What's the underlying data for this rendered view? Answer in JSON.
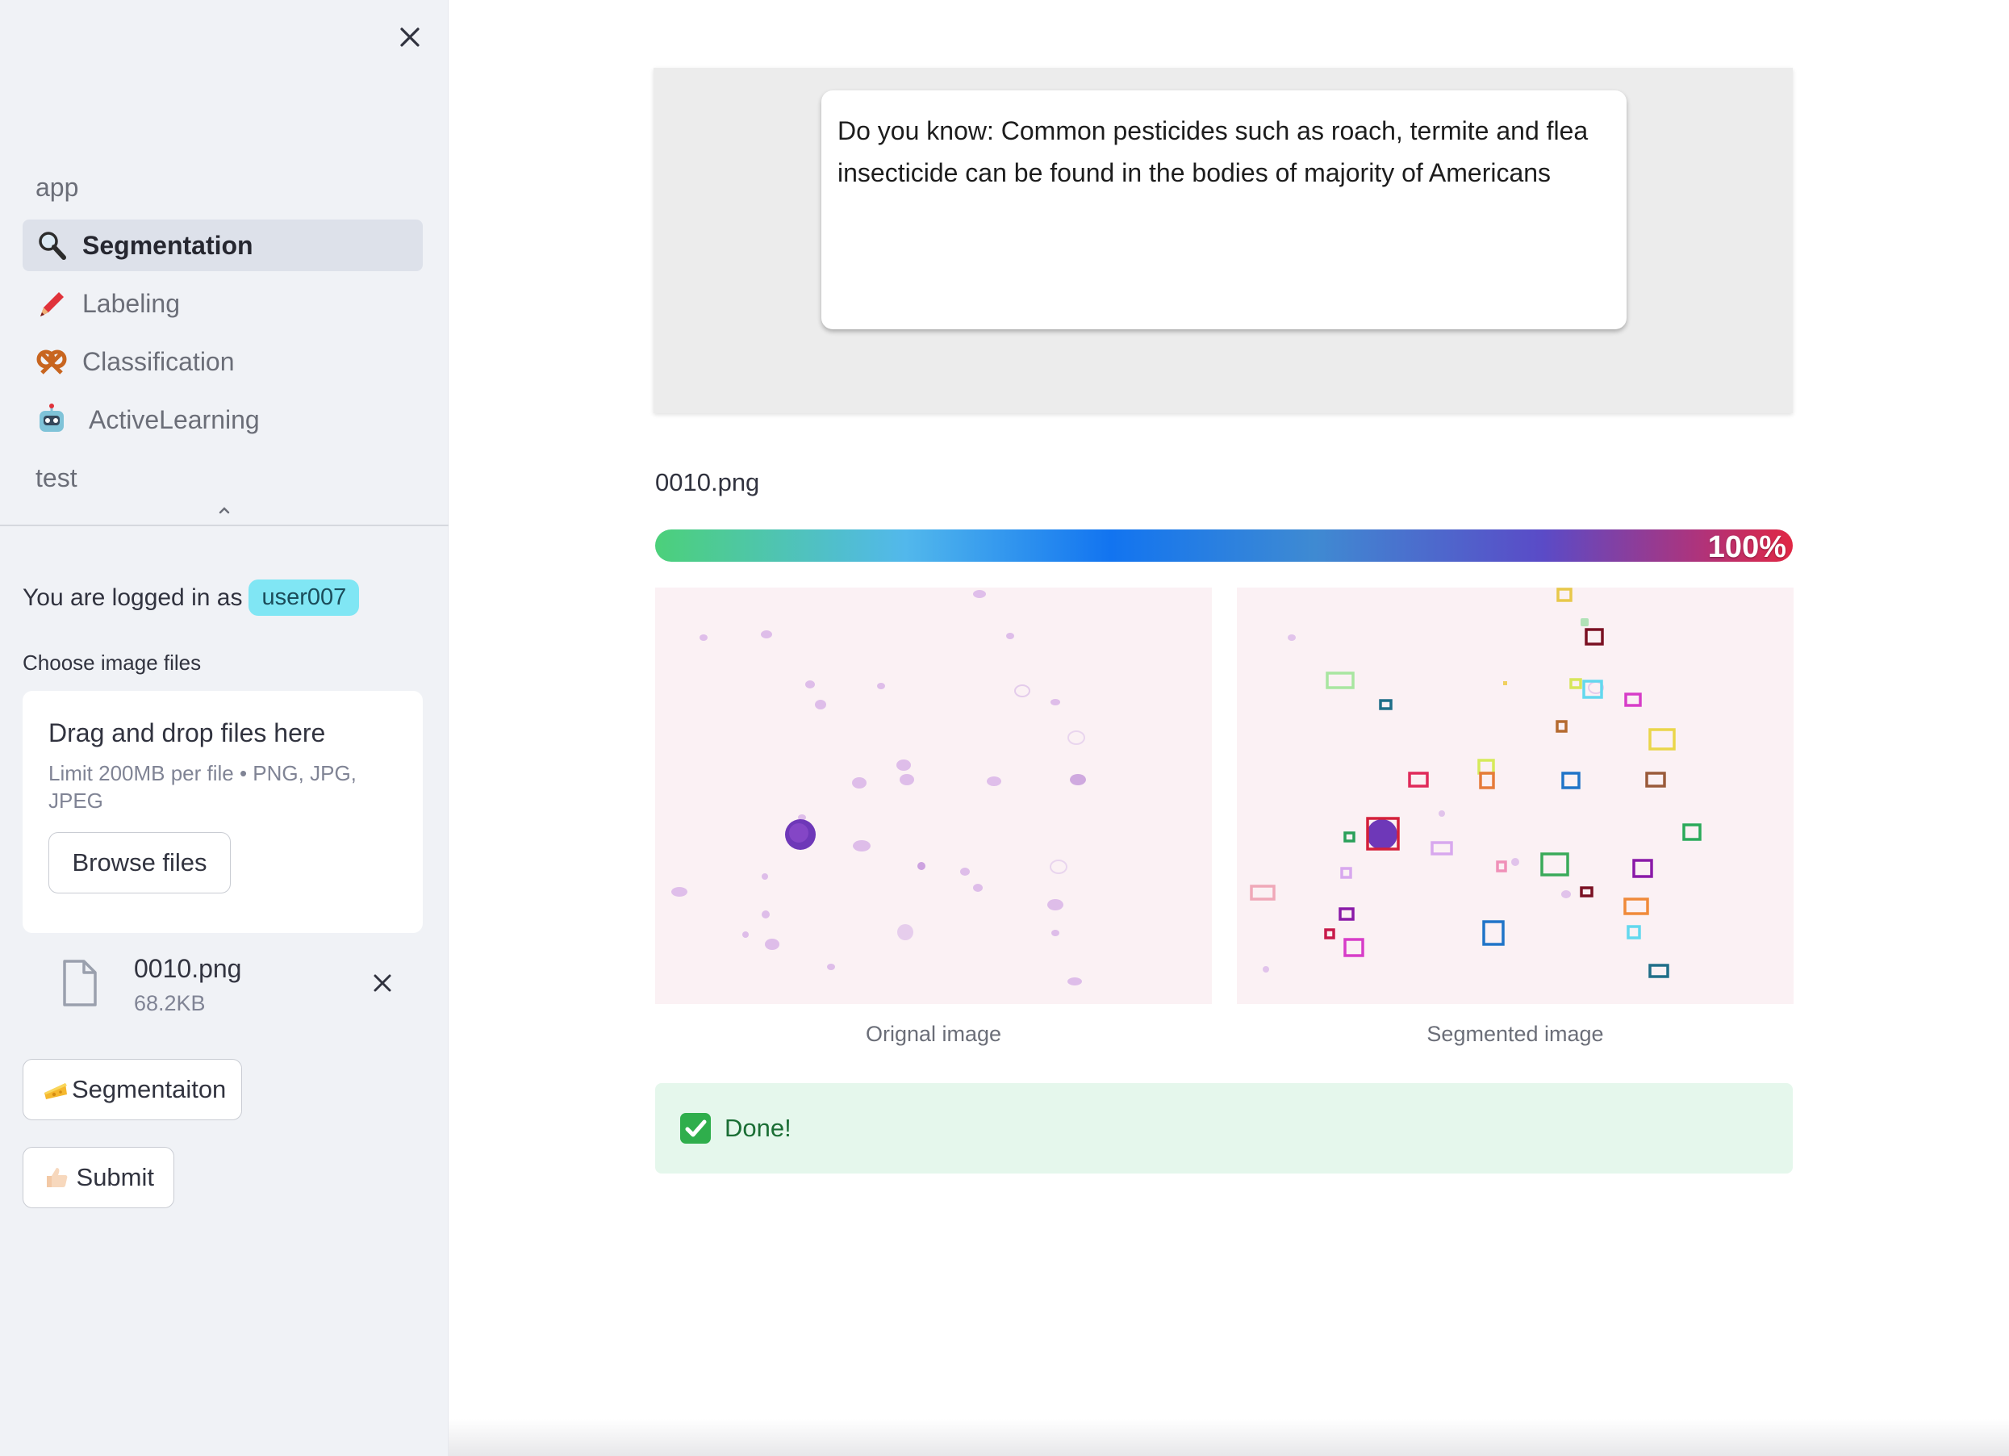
{
  "sidebar": {
    "nav": [
      {
        "label": "app",
        "icon": "",
        "active": false
      },
      {
        "label": "Segmentation",
        "icon": "magnifier-icon",
        "active": true
      },
      {
        "label": "Labeling",
        "icon": "crayon-icon",
        "active": false
      },
      {
        "label": "Classification",
        "icon": "pretzel-icon",
        "active": false
      },
      {
        "label": "ActiveLearning",
        "icon": "robot-icon",
        "active": false
      },
      {
        "label": "test",
        "icon": "",
        "active": false
      }
    ],
    "logged_in_prefix": "You are logged in as",
    "username": "user007",
    "uploader": {
      "label": "Choose image files",
      "title": "Drag and drop files here",
      "limit": "Limit 200MB per file • PNG, JPG, JPEG",
      "browse_label": "Browse files"
    },
    "file": {
      "name": "0010.png",
      "size": "68.2KB"
    },
    "segment_button": "Segmentaiton",
    "submit_button": "Submit"
  },
  "main": {
    "fact": "Do you know: Common pesticides such as roach, termite and flea insecticide can be found in the bodies of majority of Americans",
    "image_name": "0010.png",
    "progress": {
      "value": 1.0,
      "label": "100%"
    },
    "original_caption": "Orignal image",
    "segmented_caption": "Segmented image",
    "done": "Done!"
  },
  "colors": {
    "accent_badge": "#80e6f4",
    "success_bg": "#e5f7ec",
    "success_text": "#1b6e35",
    "sidebar_bg": "#f0f2f6"
  }
}
